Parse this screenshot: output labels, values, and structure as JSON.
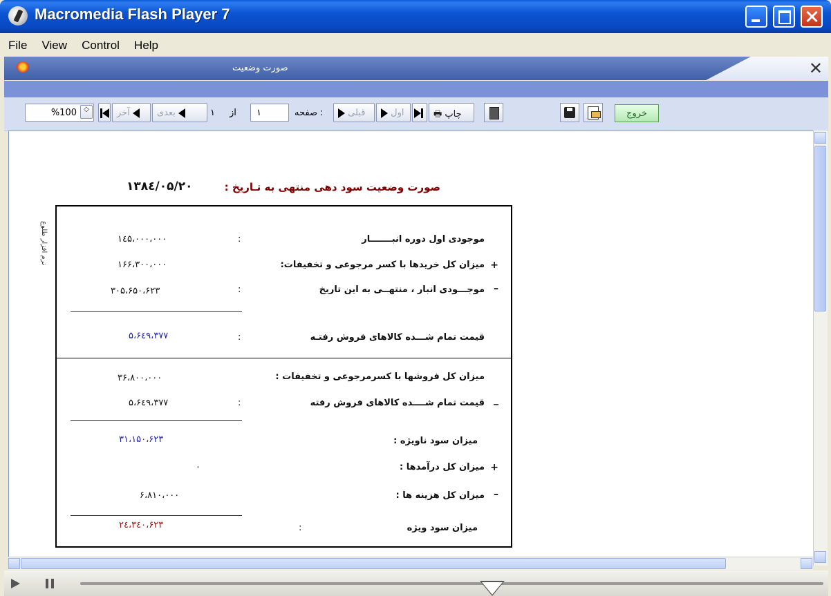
{
  "window": {
    "title": "Macromedia Flash Player 7"
  },
  "menu": [
    "File",
    "View",
    "Control",
    "Help"
  ],
  "panel": {
    "title": "صورت وضعیت"
  },
  "toolbar": {
    "zoom": "%100",
    "first": "اول",
    "prev": "قبلی",
    "page_label": "صفحه :",
    "page_value": "۱",
    "of_label": "از",
    "total_pages": "۱",
    "next": "بعدی",
    "last": "آخر",
    "print": "چاپ",
    "exit": "خروج"
  },
  "report": {
    "title": "صورت وضعیت سود دهی منتهی به تـاریخ :",
    "date": "۱۳۸٤/۰۵/۲۰",
    "side_label": "نرم افزار طلوع",
    "rows": [
      {
        "sign": "",
        "label": "موجودی اول دوره انبـــــــار",
        "value": "۱٤۵،۰۰۰،۰۰۰"
      },
      {
        "sign": "+",
        "label": "میزان کل خریدها با کسر مرجوعی و تخفیفات:",
        "value": "۱۶۶،۳۰۰،۰۰۰"
      },
      {
        "sign": "–",
        "label": "موجـــودی انبار ، منتهــی به این تاریخ",
        "value": "۳۰۵،۶۵۰،۶۲۳"
      },
      {
        "sign": "",
        "label": "قیمت تمام شـــده کالاهای فروش رفتـه",
        "value": "۵،۶٤۹،۳۷۷"
      },
      {
        "sign": "",
        "label": "میزان کل فروشها با کسرمرجوعی و تخفیفات :",
        "value": "۳۶،۸۰۰،۰۰۰"
      },
      {
        "sign": "_",
        "label": "قیمت تمام شــــده کالاهای فروش رفته",
        "value": "۵،۶٤۹،۳۷۷"
      },
      {
        "sign": "",
        "label": "میزان سود ناویژه :",
        "value": "۳۱،۱۵۰،۶۲۳"
      },
      {
        "sign": "+",
        "label": "میزان کل درآمدها :",
        "value": "۰"
      },
      {
        "sign": "–",
        "label": "میزان کل هزینه ها :",
        "value": "۶،۸۱۰،۰۰۰"
      },
      {
        "sign": "",
        "label": "میزان سود ویژه",
        "value": "۲٤،۳٤۰،۶۲۳"
      }
    ]
  },
  "colors": {
    "titlebar": "#0b54d2",
    "value_blue": "#2020a8",
    "value_red": "#a01010",
    "heading_red": "#800000"
  }
}
